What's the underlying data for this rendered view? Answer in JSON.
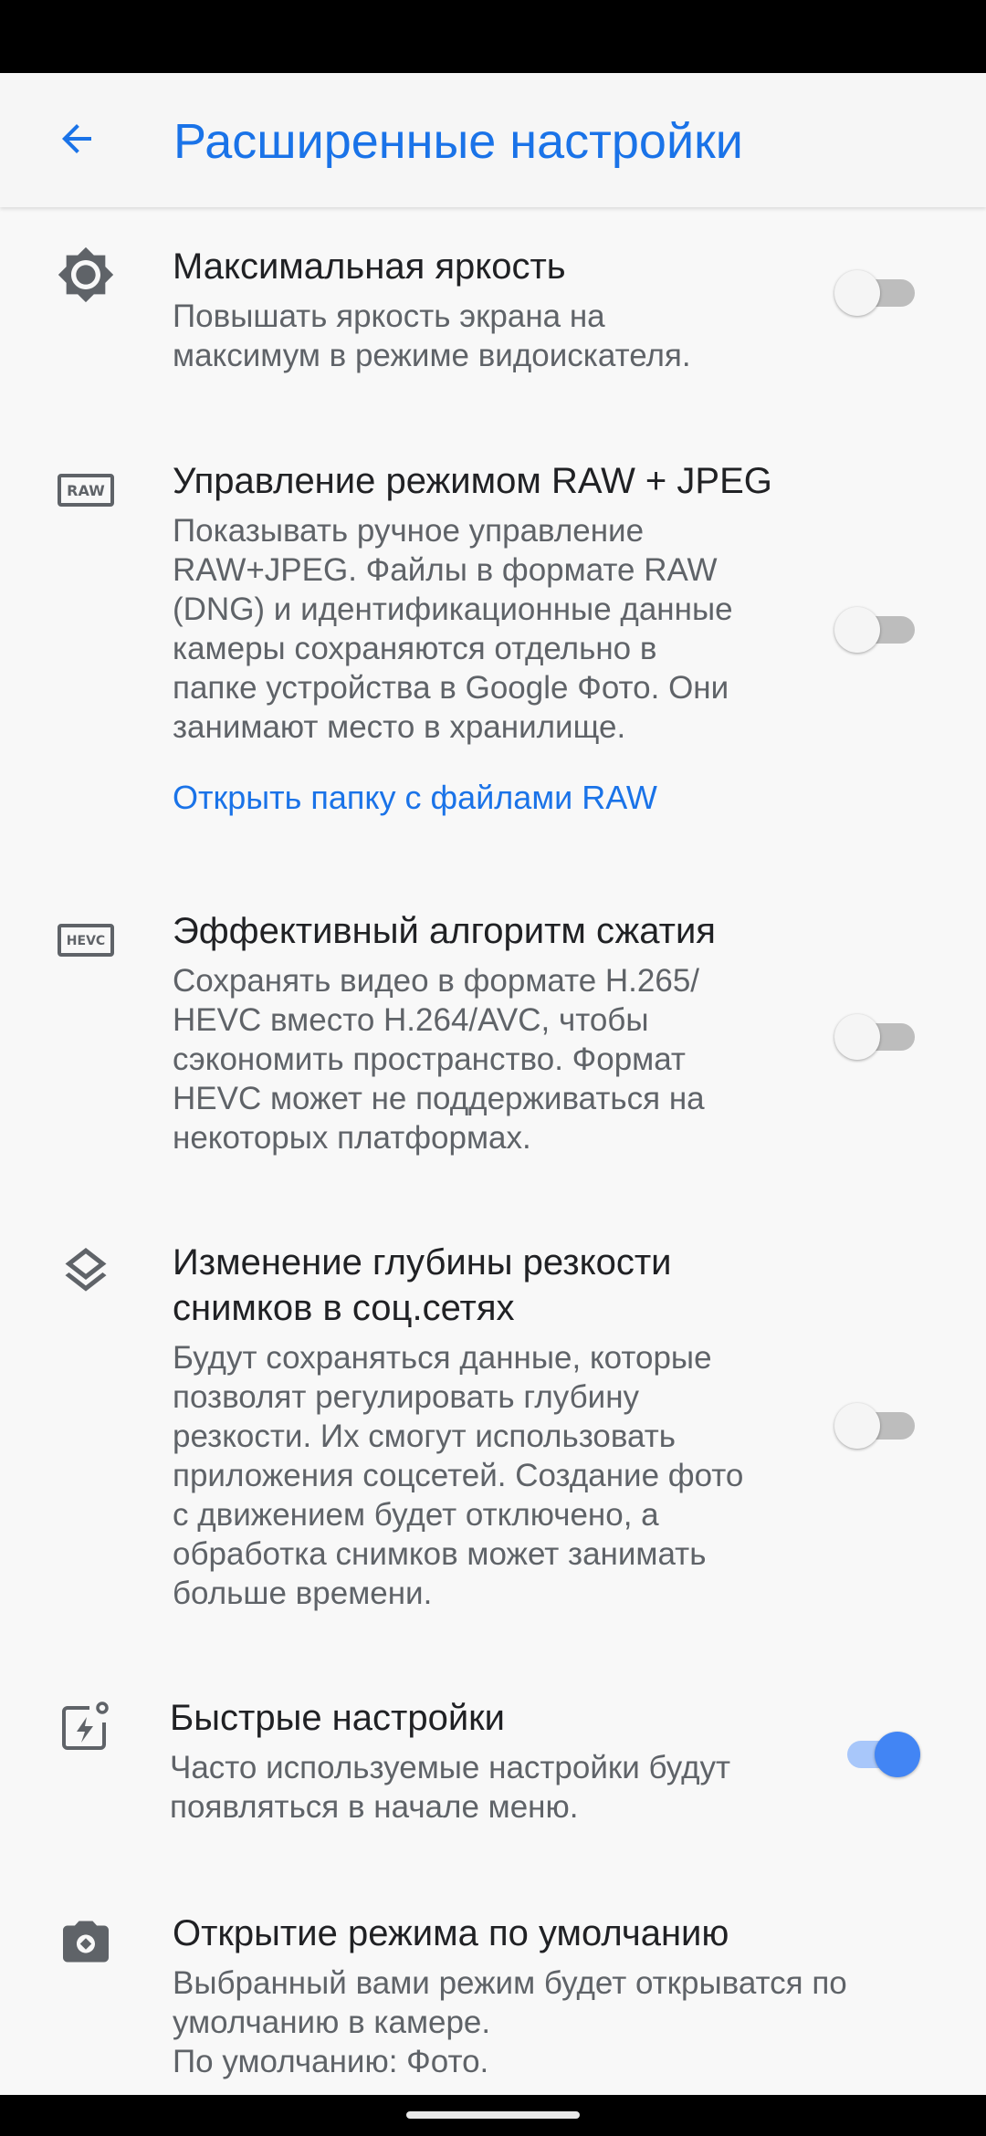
{
  "app_bar": {
    "title": "Расширенные настройки",
    "back_icon": "arrow-back-icon"
  },
  "accent_color": "#1a73e8",
  "settings": [
    {
      "icon": "brightness-icon",
      "title": "Максимальная яркость",
      "description": "Повышать яркость экрана на\nмаксимум в режиме видоискателя.",
      "enabled": false
    },
    {
      "icon": "raw-icon",
      "icon_text": "RAW",
      "title": "Управление режимом RAW + JPEG",
      "description": "Показывать ручное управление\nRAW+JPEG. Файлы в формате RAW\n(DNG) и идентификационные данные\nкамеры сохраняются отдельно в\nпапке устройства в Google Фото. Они\nзанимают место в хранилище.",
      "link": "Открыть папку с файлами RAW",
      "enabled": false
    },
    {
      "icon": "hevc-icon",
      "icon_text": "HEVC",
      "title": "Эффективный алгоритм сжатия",
      "description": "Сохранять видео в формате H.265/\nHEVC вместо H.264/AVC, чтобы\nсэкономить пространство. Формат\nHEVC может не поддерживаться на\nнекоторых платформах.",
      "enabled": false
    },
    {
      "icon": "layers-icon",
      "title": "Изменение глубины резкости\nснимков в соц.сетях",
      "description": "Будут сохраняться данные, которые\nпозволят регулировать глубину\nрезкости. Их смогут использовать\nприложения соцсетей. Создание фото\nс движением будет отключено, а\nобработка снимков может занимать\nбольше времени.",
      "enabled": false
    },
    {
      "icon": "quick-settings-icon",
      "title": "Быстрые настройки",
      "description": "Часто используемые настройки будут\nпоявляться в начале меню.",
      "enabled": true
    },
    {
      "icon": "camera-mode-icon",
      "title": "Открытие режима по умолчанию",
      "description": "Выбранный вами режим будет открыватся по\nумолчанию в камере.\nПо умолчанию: Фото."
    }
  ]
}
